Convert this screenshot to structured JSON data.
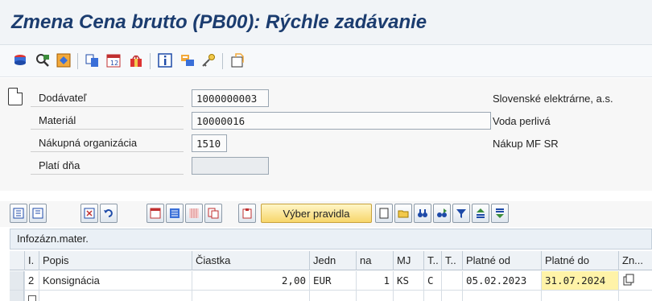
{
  "window": {
    "title": "Zmena Cena brutto (PB00): Rýchle zadávanie"
  },
  "toolbar": {
    "icons": [
      "display-change-icon",
      "other-condition-icon",
      "variable-key-icon",
      "details-icon",
      "validity-periods-icon",
      "scales-icon",
      "info-icon",
      "condition-supplement-icon",
      "key-icon",
      "additional-data-icon"
    ]
  },
  "header": {
    "fields": [
      {
        "label": "Dodávateľ",
        "value": "1000000003",
        "text": "Slovenské elektrárne, a.s."
      },
      {
        "label": "Materiál",
        "value": "10000016",
        "text": "Voda perlivá"
      },
      {
        "label": "Nákupná organizácia",
        "value": "1510",
        "text": "Nákup MF SR"
      },
      {
        "label": "Platí dňa",
        "value": "",
        "text": ""
      }
    ]
  },
  "table_toolbar": {
    "rule_button_label": "Výber pravidla"
  },
  "table": {
    "caption": "Infozázn.mater.",
    "columns": [
      "I.",
      "Popis",
      "Čiastka",
      "Jedn",
      "na",
      "MJ",
      "T..",
      "T..",
      "Platné od",
      "Platné do",
      "Zn..."
    ],
    "rows": [
      {
        "i": "2",
        "popis": "Konsignácia",
        "ciastka": "2,00",
        "jedn": "EUR",
        "na": "1",
        "mj": "KS",
        "t1": "C",
        "t2": "",
        "platne_od": "05.02.2023",
        "platne_do": "31.07.2024"
      }
    ]
  },
  "colors": {
    "title": "#1b3c6f",
    "highlight_cell": "#fff3a8",
    "rule_button": "#f7d66b"
  }
}
